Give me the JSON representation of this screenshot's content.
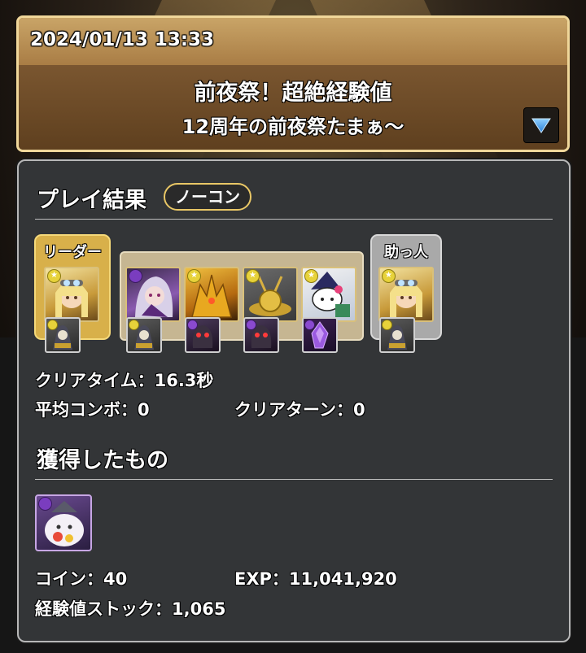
{
  "header": {
    "datetime": "2024/01/13 13:33",
    "dungeon_title": "前夜祭！超絶経験値",
    "floor_title": "12周年の前夜祭たまぁ〜",
    "expand_icon": "triangle-down-icon"
  },
  "results": {
    "section_title": "プレイ結果",
    "badge": "ノーコン",
    "team": {
      "leader_label": "リーダー",
      "helper_label": "助っ人",
      "leader": {
        "name": "blonde-girl-goggles-icon",
        "attr": "light"
      },
      "subs": [
        {
          "name": "purple-hair-girl-icon",
          "attr": "dark"
        },
        {
          "name": "golden-dragon-icon",
          "attr": "light"
        },
        {
          "name": "golden-snail-icon",
          "attr": "light"
        },
        {
          "name": "hello-kitty-witch-icon",
          "attr": "light"
        }
      ],
      "helper": {
        "name": "blonde-girl-goggles-icon",
        "attr": "light"
      },
      "assists": [
        {
          "name": "cloaked-skull-assist-icon",
          "attr": "light"
        },
        {
          "name": "cloaked-skull-assist-icon",
          "attr": "light"
        },
        {
          "name": "red-eye-helmet-assist-icon",
          "attr": "dark"
        },
        {
          "name": "red-eye-helmet-assist-icon",
          "attr": "dark"
        },
        {
          "name": "purple-crystal-assist-icon",
          "attr": "dark"
        },
        {
          "name": "cloaked-skull-assist-icon",
          "attr": "light"
        }
      ]
    },
    "clear_time_label": "クリアタイム：",
    "clear_time_value": "16.3秒",
    "avg_combo_label": "平均コンボ：",
    "avg_combo_value": "0",
    "clear_turn_label": "クリアターン：",
    "clear_turn_value": "0"
  },
  "rewards": {
    "section_title": "獲得したもの",
    "items": [
      {
        "name": "white-cat-mage-icon",
        "attr": "dark"
      }
    ],
    "coin_label": "コイン：",
    "coin_value": "40",
    "exp_label": "EXP：",
    "exp_value": "11,041,920",
    "stock_label": "経験値ストック：",
    "stock_value": "1,065"
  },
  "colors": {
    "panel_bg": "#333537",
    "leader_frame": "#d8b04a",
    "helper_frame": "#a9a9a9",
    "badge_border": "#e9c766",
    "header_brown": "#6b4a24"
  }
}
